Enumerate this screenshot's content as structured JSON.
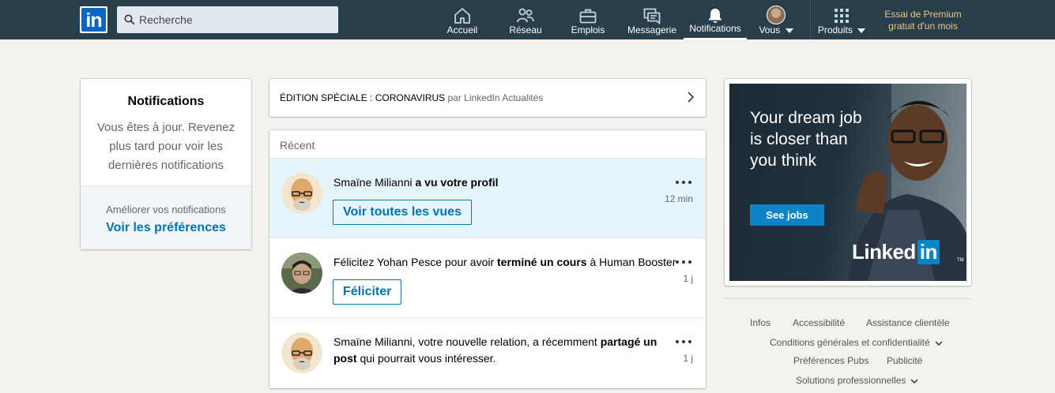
{
  "nav": {
    "logo": "in",
    "search_placeholder": "Recherche",
    "items": [
      {
        "label": "Accueil",
        "icon": "home-icon"
      },
      {
        "label": "Réseau",
        "icon": "network-icon"
      },
      {
        "label": "Emplois",
        "icon": "briefcase-icon"
      },
      {
        "label": "Messagerie",
        "icon": "messaging-icon"
      },
      {
        "label": "Notifications",
        "icon": "bell-icon",
        "active": true
      },
      {
        "label": "Vous",
        "icon": "avatar"
      },
      {
        "label": "Produits",
        "icon": "grid-icon"
      }
    ],
    "premium_line1": "Essai de Premium",
    "premium_line2": "gratuit d'un mois"
  },
  "left": {
    "title": "Notifications",
    "message": "Vous êtes à jour. Revenez plus tard pour voir les dernières notifications",
    "improve": "Améliorer vos notifications",
    "preferences_link": "Voir les préférences"
  },
  "edition": {
    "title": "ÉDITION SPÉCIALE : CORONAVIRUS",
    "by": "par LinkedIn Actualités"
  },
  "feed": {
    "header": "Récent",
    "items": [
      {
        "name": "Smaïne Milianni",
        "action": "a vu votre profil",
        "time": "12 min",
        "button": "Voir toutes les vues",
        "unread": true
      },
      {
        "pre": "Félicitez Yohan Pesce pour avoir",
        "action": "terminé un cours",
        "post": "à Human Booster",
        "time": "1 j",
        "button": "Féliciter"
      },
      {
        "pre": "Smaïne Milianni, votre nouvelle relation, a récemment",
        "action": "partagé un post",
        "post": "qui pourrait vous intéresser.",
        "time": "1 j"
      }
    ]
  },
  "ad": {
    "headline": "Your dream job is closer than you think",
    "button": "See jobs",
    "brand_left": "Linked",
    "brand_right": "in",
    "tm": "TM"
  },
  "footer": {
    "infos": "Infos",
    "accessibilite": "Accessibilité",
    "assistance": "Assistance clientèle",
    "conditions": "Conditions générales et confidentialité",
    "preferences_pubs": "Préférences Pubs",
    "publicite": "Publicité",
    "solutions": "Solutions professionnelles"
  },
  "colors": {
    "nav_bg": "#283e4a",
    "link_blue": "#0073b1",
    "unread_bg": "#e6f4fb",
    "premium_gold": "#ecc581"
  }
}
